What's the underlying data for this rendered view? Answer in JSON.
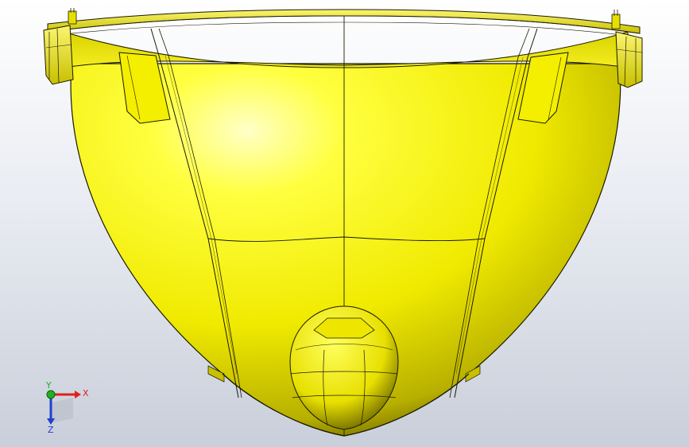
{
  "viewport": {
    "background_top": "#ffffff",
    "background_bottom": "#c9cfda"
  },
  "model": {
    "color": "#f5f200",
    "edge_color": "#1a1a00",
    "shade_color": "#8a8600"
  },
  "triad": {
    "x_label": "X",
    "y_label": "Y",
    "z_label": "Z",
    "x_color": "#e02020",
    "y_color": "#20b020",
    "z_color": "#2040d0"
  }
}
